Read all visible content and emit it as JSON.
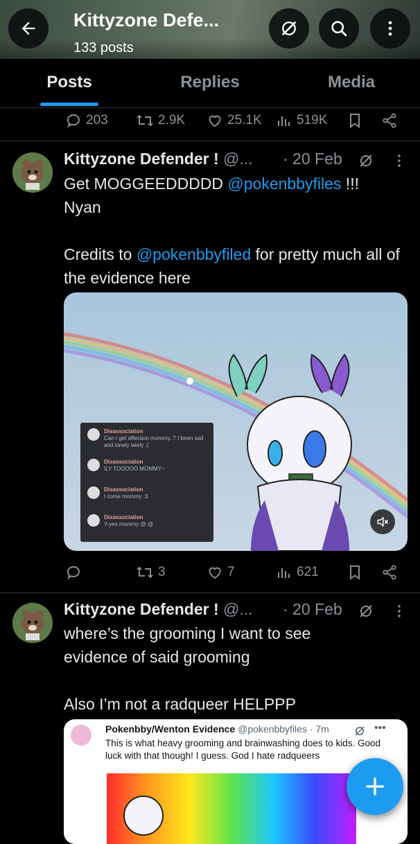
{
  "header": {
    "title": "Kittyzone Defe...",
    "post_count": "133 posts"
  },
  "tabs": [
    {
      "label": "Posts",
      "active": true
    },
    {
      "label": "Replies",
      "active": false
    },
    {
      "label": "Media",
      "active": false
    }
  ],
  "prev_actions": {
    "replies": "203",
    "reposts": "2.9K",
    "likes": "25.1K",
    "views": "519K"
  },
  "tweet1": {
    "name": "Kittyzone Defender !",
    "handle": "@...",
    "date": "· 20 Feb",
    "text_a": "Get MOGGEEDDDDD ",
    "mention_a": "@pokenbbyfiles",
    "text_b": " !!!",
    "line2": "Nyan",
    "line3a": "Credits to ",
    "mention_b": "@pokenbbyfiled",
    "line3b": " for pretty much all of the evidence here",
    "chat": [
      {
        "user": "Disassociation",
        "msg": "Can I get affection mommy..? I been sad and lonely lately :("
      },
      {
        "user": "Disassociation",
        "msg": "ILY TOOOOO MOMMY~"
      },
      {
        "user": "Disassociation",
        "msg": "I come mommy :3"
      },
      {
        "user": "Disassociation",
        "msg": "Y-yes mommy @ @"
      }
    ],
    "actions": {
      "replies": "",
      "reposts": "3",
      "likes": "7",
      "views": "621"
    }
  },
  "tweet2": {
    "name": "Kittyzone Defender !",
    "handle": "@...",
    "date": "· 20 Feb",
    "line1": "where’s the grooming I want to see",
    "line2": "evidence of said grooming",
    "line3": "Also I’m not a radqueer HELPPP",
    "quote": {
      "name": "Pokenbby/Wenton Evidence",
      "handle": "@pokenbbyfiles · 7m",
      "text": "This is what heavy grooming and brainwashing does to kids. Good luck with that though! I guess. God I hate radqueers"
    }
  },
  "colors": {
    "accent": "#1d9bf0",
    "background": "#000000",
    "muted": "#8b9198"
  }
}
